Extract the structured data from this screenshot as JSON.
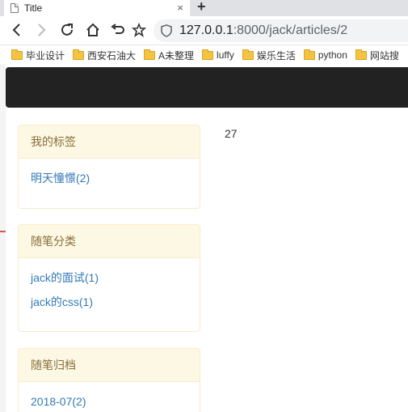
{
  "browser": {
    "tab_title": "Title",
    "tab_close": "×",
    "new_tab": "+",
    "url_host": "127.0.0.1",
    "url_rest": ":8000/jack/articles/2",
    "bookmarks": [
      "毕业设计",
      "西安石油大",
      "A未整理",
      "luffy",
      "娱乐生活",
      "python",
      "网站搜"
    ]
  },
  "page": {
    "article_count": "27",
    "panels": [
      {
        "title": "我的标签",
        "links": [
          "明天憧憬(2)"
        ]
      },
      {
        "title": "随笔分类",
        "links": [
          "jack的面试(1)",
          "jack的css(1)"
        ]
      },
      {
        "title": "随笔归档",
        "links": [
          "2018-07(2)"
        ]
      }
    ]
  }
}
